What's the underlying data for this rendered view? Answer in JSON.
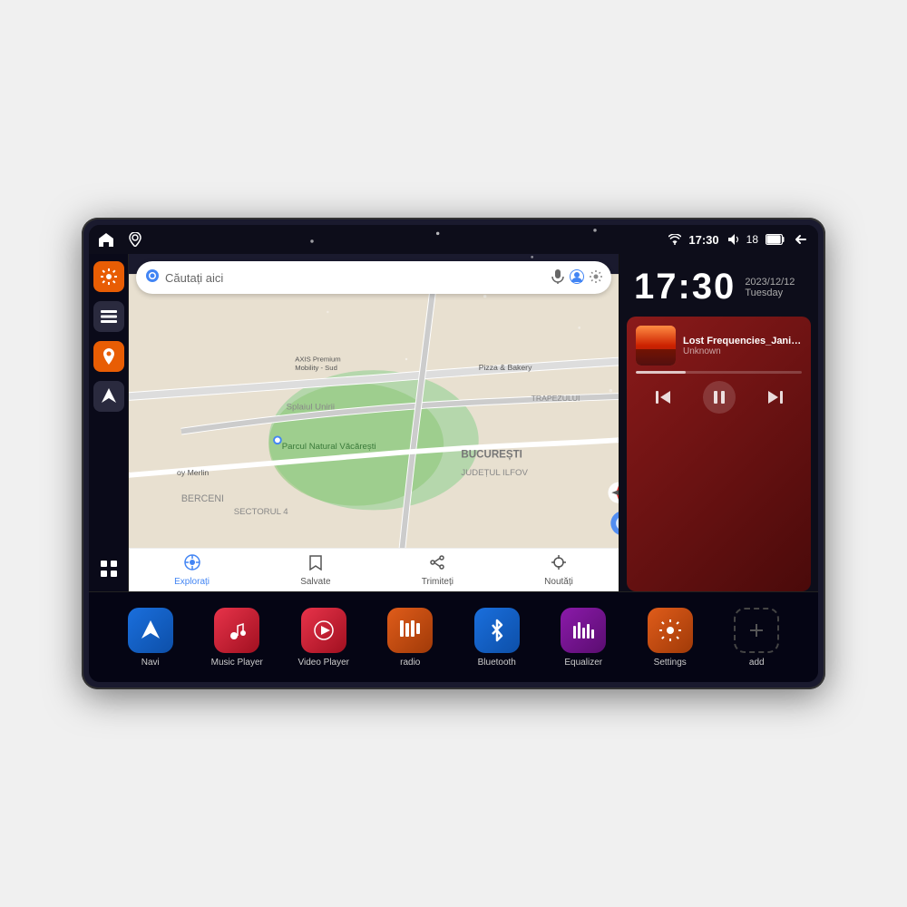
{
  "device": {
    "statusBar": {
      "leftIcons": [
        "home",
        "map"
      ],
      "time": "17:30",
      "rightIcons": [
        "wifi",
        "volume",
        "battery",
        "back"
      ],
      "batteryLevel": "18"
    },
    "clock": {
      "time": "17:30",
      "date": "2023/12/12",
      "day": "Tuesday"
    },
    "music": {
      "title": "Lost Frequencies_Janie...",
      "artist": "Unknown",
      "progress": 30
    },
    "map": {
      "searchPlaceholder": "Căutați aici",
      "locations": [
        "Parcul Natural Văcărești",
        "Pizza & Bakery",
        "AXIS Premium Mobility - Sud",
        "BUCUREȘTI",
        "JUDEȚUL ILFOV",
        "SECTORUL 4",
        "BERCENI",
        "TRAPEZULUI"
      ],
      "bottomNav": [
        "Explorați",
        "Salvate",
        "Trimiteți",
        "Noutăți"
      ]
    },
    "apps": [
      {
        "id": "navi",
        "label": "Navi",
        "colorClass": "app-navi",
        "icon": "▲"
      },
      {
        "id": "music-player",
        "label": "Music Player",
        "colorClass": "app-music",
        "icon": "♪"
      },
      {
        "id": "video-player",
        "label": "Video Player",
        "colorClass": "app-video",
        "icon": "▶"
      },
      {
        "id": "radio",
        "label": "radio",
        "colorClass": "app-radio",
        "icon": "📻"
      },
      {
        "id": "bluetooth",
        "label": "Bluetooth",
        "colorClass": "app-bt",
        "icon": "⚡"
      },
      {
        "id": "equalizer",
        "label": "Equalizer",
        "colorClass": "app-eq",
        "icon": "🎚"
      },
      {
        "id": "settings",
        "label": "Settings",
        "colorClass": "app-settings",
        "icon": "⚙"
      },
      {
        "id": "add",
        "label": "add",
        "colorClass": "app-add",
        "icon": "+"
      }
    ],
    "sidebar": [
      {
        "id": "settings",
        "icon": "⚙",
        "colorClass": "orange"
      },
      {
        "id": "files",
        "icon": "▬",
        "colorClass": "dark"
      },
      {
        "id": "map",
        "icon": "📍",
        "colorClass": "orange"
      },
      {
        "id": "nav",
        "icon": "▲",
        "colorClass": "dark"
      }
    ],
    "controls": {
      "prev": "⏮",
      "pause": "⏸",
      "next": "⏭"
    }
  }
}
